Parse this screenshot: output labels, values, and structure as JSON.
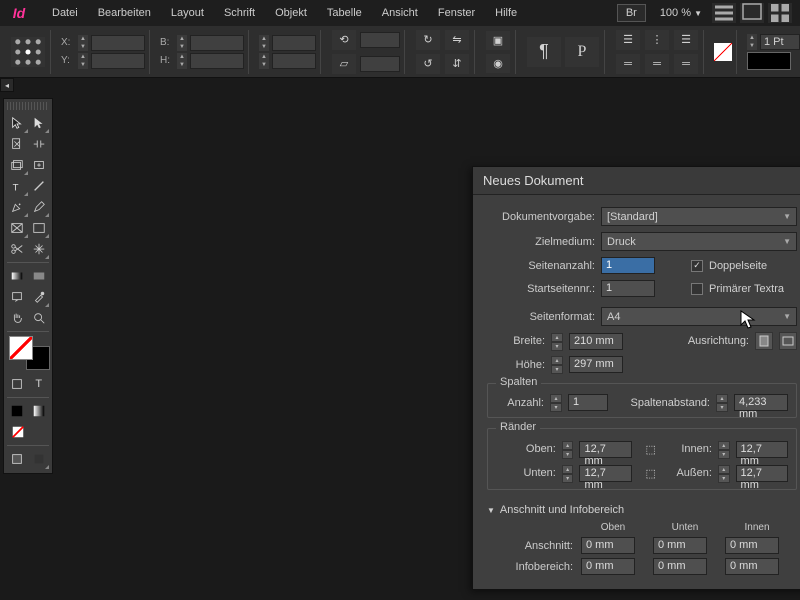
{
  "menubar": {
    "items": [
      "Datei",
      "Bearbeiten",
      "Layout",
      "Schrift",
      "Objekt",
      "Tabelle",
      "Ansicht",
      "Fenster",
      "Hilfe"
    ],
    "br_label": "Br",
    "zoom": "100 %"
  },
  "controlbar": {
    "x_label": "X:",
    "y_label": "Y:",
    "b_label": "B:",
    "h_label": "H:",
    "stroke_value": "1 Pt"
  },
  "dialog": {
    "title": "Neues Dokument",
    "preset_label": "Dokumentvorgabe:",
    "preset_value": "[Standard]",
    "intent_label": "Zielmedium:",
    "intent_value": "Druck",
    "pages_label": "Seitenanzahl:",
    "pages_value": "1",
    "facing_label": "Doppelseite",
    "start_label": "Startseitennr.:",
    "start_value": "1",
    "primary_tf_label": "Primärer Textra",
    "pagesize_label": "Seitenformat:",
    "pagesize_value": "A4",
    "width_label": "Breite:",
    "width_value": "210 mm",
    "height_label": "Höhe:",
    "height_value": "297 mm",
    "orientation_label": "Ausrichtung:",
    "columns": {
      "legend": "Spalten",
      "count_label": "Anzahl:",
      "count_value": "1",
      "gutter_label": "Spaltenabstand:",
      "gutter_value": "4,233 mm"
    },
    "margins": {
      "legend": "Ränder",
      "top_label": "Oben:",
      "top_value": "12,7 mm",
      "bottom_label": "Unten:",
      "bottom_value": "12,7 mm",
      "inside_label": "Innen:",
      "inside_value": "12,7 mm",
      "outside_label": "Außen:",
      "outside_value": "12,7 mm"
    },
    "bleed": {
      "legend": "Anschnitt und Infobereich",
      "col_top": "Oben",
      "col_bottom": "Unten",
      "col_inside": "Innen",
      "bleed_label": "Anschnitt:",
      "bleed_top": "0 mm",
      "bleed_bottom": "0 mm",
      "bleed_inside": "0 mm",
      "slug_label": "Infobereich:",
      "slug_top": "0 mm",
      "slug_bottom": "0 mm",
      "slug_inside": "0 mm"
    }
  }
}
